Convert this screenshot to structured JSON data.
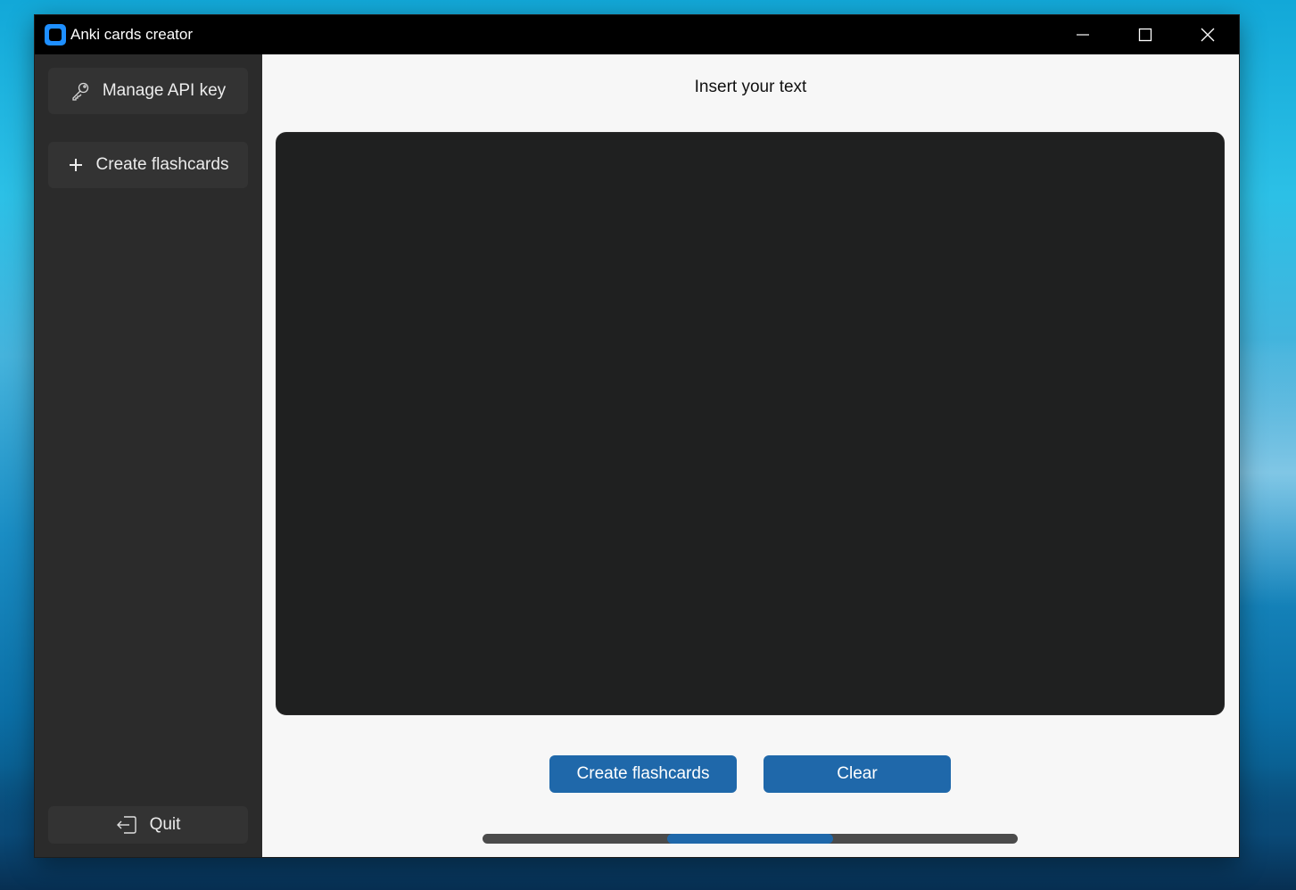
{
  "window": {
    "title": "Anki cards creator",
    "controls": [
      "minimize-icon",
      "maximize-icon",
      "close-icon"
    ]
  },
  "sidebar": {
    "items": [
      {
        "label": "Manage API key",
        "icon": "key-icon"
      },
      {
        "label": "Create flashcards",
        "icon": "plus-icon"
      }
    ],
    "quit": {
      "label": "Quit",
      "icon": "exit-icon"
    }
  },
  "main": {
    "title": "Insert your text",
    "textbox": {
      "value": ""
    },
    "buttons": {
      "create": "Create flashcards",
      "clear": "Clear"
    },
    "progress": {
      "indeterminate": true,
      "segment_start": 0.345,
      "segment_end": 0.655
    }
  },
  "colors": {
    "accent": "#1f68aa",
    "sidebar_bg": "#2b2b2b",
    "textbox_bg": "#1f2020",
    "titlebar_bg": "#000000"
  }
}
